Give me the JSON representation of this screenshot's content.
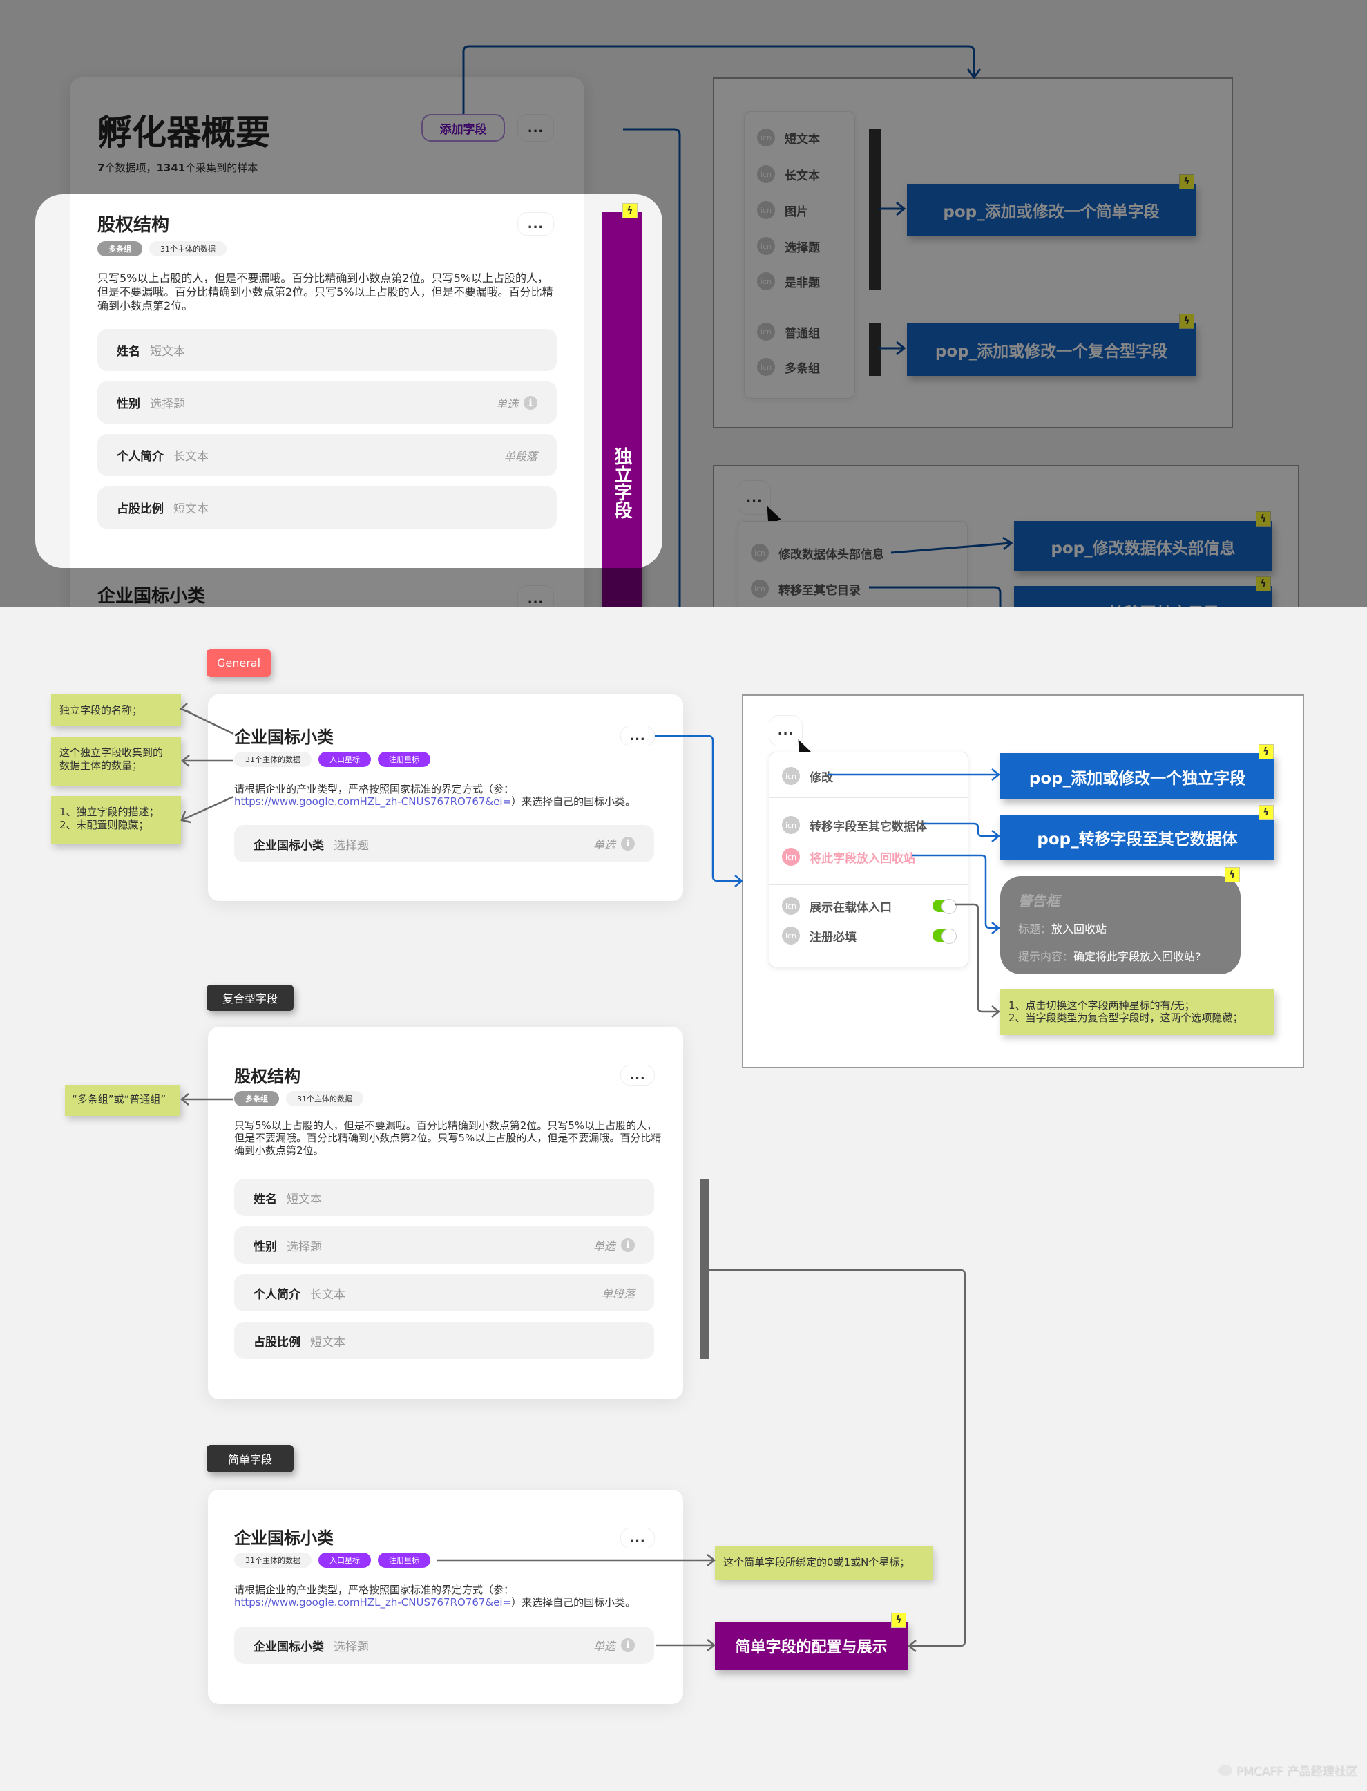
{
  "top": {
    "overview": {
      "title": "孵化器概要",
      "subtitle_count_items": "7",
      "subtitle_items_suffix": "个数据项，",
      "subtitle_count_samples": "1341",
      "subtitle_samples_suffix": "个采集到的样本",
      "add_field_button": "添加字段",
      "more_button": "...",
      "highlight_card": {
        "title": "股权结构",
        "more_button": "...",
        "chips": [
          "多条组",
          "31个主体的数据"
        ],
        "description": "只写5%以上占股的人，但是不要漏哦。百分比精确到小数点第2位。只写5%以上占股的人，但是不要漏哦。百分比精确到小数点第2位。只写5%以上占股的人，但是不要漏哦。百分比精确到小数点第2位。",
        "fields": [
          {
            "label": "姓名",
            "type": "短文本",
            "right": ""
          },
          {
            "label": "性别",
            "type": "选择题",
            "right": "单选"
          },
          {
            "label": "个人简介",
            "type": "长文本",
            "right": "单段落"
          },
          {
            "label": "占股比例",
            "type": "短文本",
            "right": ""
          }
        ]
      },
      "next_card_title": "企业国标小类",
      "next_card_more": "...",
      "side_bar_label": "独立字段"
    },
    "add_field_menu": {
      "simple_items": [
        "短文本",
        "长文本",
        "图片",
        "选择题",
        "是非题"
      ],
      "group_items": [
        "普通组",
        "多条组"
      ],
      "icon_text": "icn",
      "pop_simple": "pop_添加或修改一个简单字段",
      "pop_complex": "pop_添加或修改一个复合型字段"
    },
    "header_more_menu": {
      "more_button": "...",
      "items": [
        "修改数据体头部信息",
        "转移至其它目录"
      ],
      "pop_edit_header": "pop_修改数据体头部信息",
      "pop_move": "pop_转移至其它目录"
    }
  },
  "general": {
    "tag": "General",
    "card": {
      "title": "企业国标小类",
      "more_button": "...",
      "chips": [
        "31个主体的数据",
        "入口星标",
        "注册星标"
      ],
      "description_prefix": "请根据企业的产业类型，严格按照国家标准的界定方式（参：",
      "description_link": "https://www.google.comHZL_zh-CNUS767RO767&ei=",
      "description_suffix": "）来选择自己的国标小类。",
      "field": {
        "label": "企业国标小类",
        "type": "选择题",
        "right": "单选"
      }
    },
    "notes": [
      "独立字段的名称；",
      "这个独立字段收集到的数据主体的数量；",
      "1、独立字段的描述；\n2、未配置则隐藏；"
    ],
    "field_menu": {
      "more_button": "...",
      "items": [
        {
          "label": "修改",
          "style": "normal"
        },
        {
          "label": "转移字段至其它数据体",
          "style": "normal"
        },
        {
          "label": "将此字段放入回收站",
          "style": "danger"
        },
        {
          "label": "展示在载体入口",
          "style": "toggle",
          "on": true
        },
        {
          "label": "注册必填",
          "style": "toggle",
          "on": true
        }
      ],
      "icon_text": "icn",
      "pop_edit": "pop_添加或修改一个独立字段",
      "pop_move": "pop_转移字段至其它数据体",
      "alert": {
        "title": "警告框",
        "title_key": "标题：",
        "title_value": "放入回收站",
        "content_key": "提示内容：",
        "content_value": "确定将此字段放入回收站?"
      },
      "toggle_note": "1、点击切换这个字段两种星标的有/无；\n2、当字段类型为复合型字段时，这两个选项隐藏；"
    }
  },
  "complex": {
    "tag": "复合型字段",
    "note": "“多条组”或“普通组”",
    "card": {
      "title": "股权结构",
      "more_button": "...",
      "chips": [
        "多条组",
        "31个主体的数据"
      ],
      "description": "只写5%以上占股的人，但是不要漏哦。百分比精确到小数点第2位。只写5%以上占股的人，但是不要漏哦。百分比精确到小数点第2位。只写5%以上占股的人，但是不要漏哦。百分比精确到小数点第2位。",
      "fields": [
        {
          "label": "姓名",
          "type": "短文本",
          "right": ""
        },
        {
          "label": "性别",
          "type": "选择题",
          "right": "单选"
        },
        {
          "label": "个人简介",
          "type": "长文本",
          "right": "单段落"
        },
        {
          "label": "占股比例",
          "type": "短文本",
          "right": ""
        }
      ]
    }
  },
  "simple": {
    "tag": "简单字段",
    "card": {
      "title": "企业国标小类",
      "more_button": "...",
      "chips": [
        "31个主体的数据",
        "入口星标",
        "注册星标"
      ],
      "description_prefix": "请根据企业的产业类型，严格按照国家标准的界定方式（参：",
      "description_link": "https://www.google.comHZL_zh-CNUS767RO767&ei=",
      "description_suffix": "）来选择自己的国标小类。",
      "field": {
        "label": "企业国标小类",
        "type": "选择题",
        "right": "单选"
      }
    },
    "star_note": "这个简单字段所绑定的0或1或N个星标；",
    "config_box": "简单字段的配置与展示"
  },
  "info_icon": "i",
  "bolt_icon": "ϟ",
  "watermark": "PMCAFF 产品经理社区",
  "colors": {
    "blue": "#1466c8",
    "purple": "#800080",
    "chip_purple": "#9933ff",
    "note_green": "#d4e17d",
    "general_red": "#ff6666",
    "danger_pink": "#f8a2b4",
    "toggle_green": "#66cc00"
  }
}
